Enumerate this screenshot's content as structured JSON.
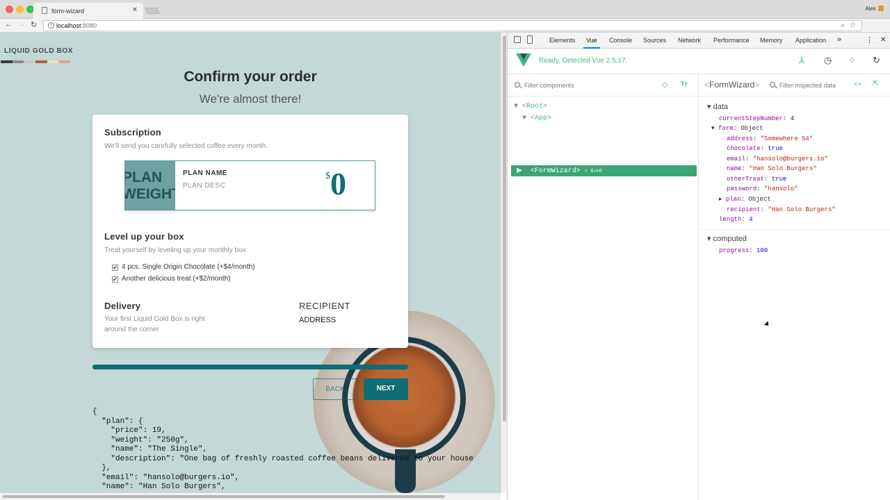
{
  "browser": {
    "tab_title": "form-wizard",
    "user": "Alex",
    "url_host": "localhost",
    "url_port": ":8080"
  },
  "app": {
    "brand": "LIQUID GOLD BOX",
    "swatch_colors": [
      "#3a3a3a",
      "#8a8a8a",
      "#c9c9c9",
      "#a86445",
      "#e8dccc",
      "#d9a98c"
    ],
    "title": "Confirm your order",
    "subtitle": "We're almost there!",
    "subscription": {
      "heading": "Subscription",
      "desc": "We'll send you carefully selected coffee every month."
    },
    "plan": {
      "image_text_line1": "PLAN",
      "image_text_line2": "WEIGHT",
      "name": "PLAN NAME",
      "desc": "PLAN DESC",
      "currency": "$",
      "price": "0"
    },
    "levelup": {
      "heading": "Level up your box",
      "desc": "Treat yourself by leveling up your monthly box",
      "options": [
        "4 pcs. Single Origin Chocolate (+$4/month)",
        "Another delicious treat (+$2/month)"
      ]
    },
    "delivery": {
      "heading": "Delivery",
      "desc_line1": "Your first Liquid Gold Box is right",
      "desc_line2": "around the corner",
      "recipient_heading": "RECIPIENT",
      "address": "ADDRESS"
    },
    "progress": 1.0,
    "back_label": "BACK",
    "next_label": "NEXT",
    "json_dump": "{\n  \"plan\": {\n    \"price\": 19,\n    \"weight\": \"250g\",\n    \"name\": \"The Single\",\n    \"description\": \"One bag of freshly roasted coffee beans delivered to your house\n  },\n  \"email\": \"hansolo@burgers.io\",\n  \"name\": \"Han Solo Burgers\","
  },
  "devtools": {
    "tabs": [
      "Elements",
      "Vue",
      "Console",
      "Sources",
      "Network",
      "Performance",
      "Memory",
      "Application"
    ],
    "more": "»",
    "vue_status": "Ready. Detected Vue 2.5.17.",
    "filter_components_ph": "Filter components",
    "filter_data_ph": "Filter inspected data",
    "tree": {
      "root": "Root",
      "app": "App",
      "formwizard": "FormWizard",
      "vm": "= $vm0"
    },
    "inspected_name": "FormWizard",
    "data_label": "data",
    "computed_label": "computed",
    "data": {
      "currentStepNumber": "4",
      "form": "Object",
      "address": "\"Somewhere 54\"",
      "chocolate": "true",
      "email": "\"hansolo@burgers.io\"",
      "name": "\"Han Solo Burgers\"",
      "otherTreat": "true",
      "password": "\"hansolo\"",
      "plan": "Object",
      "recipient": "\"Han Solo Burgers\"",
      "length": "4"
    },
    "computed": {
      "progress": "100"
    }
  }
}
